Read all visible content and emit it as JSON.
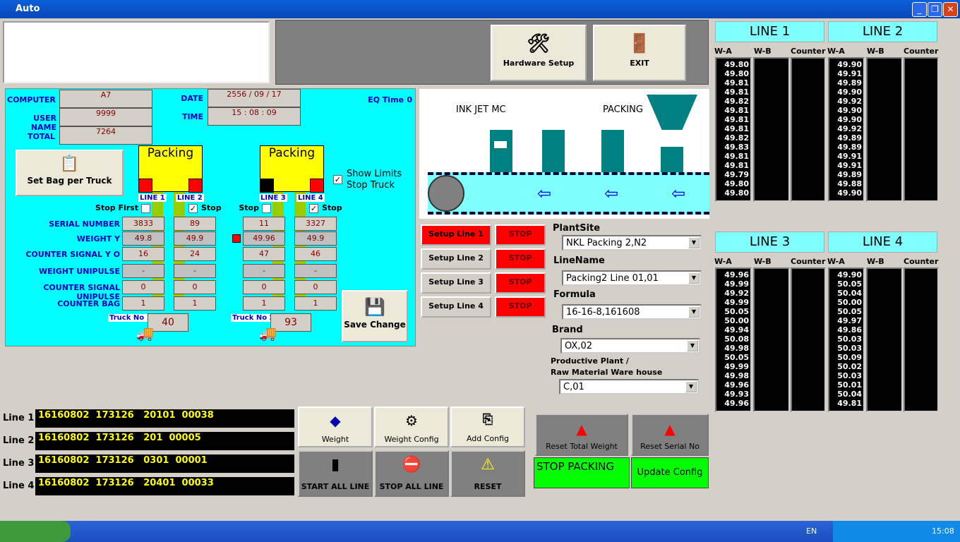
{
  "window": {
    "title": "Auto",
    "min": "_",
    "max": "❐",
    "close": "✕"
  },
  "toolbar": {
    "hardware_setup": "Hardware Setup",
    "exit": "EXIT"
  },
  "info": {
    "computer_label": "COMPUTER",
    "computer_value": "A7",
    "username_label": "USER NAME",
    "username_value": "9999",
    "total_label": "TOTAL",
    "total_value": "7264",
    "date_label": "DATE",
    "date_value": "2556 / 09 / 17",
    "time_label": "TIME",
    "time_value": "15 : 08 : 09",
    "eq_time_label": "EQ Time",
    "eq_time_value": "0"
  },
  "set_bag_button": "Set Bag per Truck",
  "packing_label": "Packing",
  "show_limits": "Show Limits",
  "stop_truck": "Stop Truck",
  "show_limits_checked": true,
  "row_labels": [
    "SERIAL NUMBER",
    "WEIGHT Y",
    "COUNTER SIGNAL Y O",
    "WEIGHT UNIPULSE",
    "COUNTER SIGNAL UNIPULSE",
    "COUNTER BAG"
  ],
  "lines": [
    {
      "label": "LINE 1",
      "stop_label": "Stop First",
      "stop_checked": false,
      "values": [
        "3833",
        "49.8",
        "16",
        "-",
        "0",
        "1"
      ],
      "lamp_color": "#ff0000"
    },
    {
      "label": "LINE 2",
      "stop_label": "Stop",
      "stop_checked": true,
      "values": [
        "89",
        "49.9",
        "24",
        "-",
        "0",
        "1"
      ],
      "lamp_color": "#ff0000"
    },
    {
      "label": "LINE 3",
      "stop_label": "Stop",
      "stop_checked": false,
      "values": [
        "11",
        "49.96",
        "47",
        "-",
        "0",
        "1"
      ],
      "lamp_color": "#000000"
    },
    {
      "label": "LINE 4",
      "stop_label": "Stop",
      "stop_checked": true,
      "values": [
        "3327",
        "49.9",
        "46",
        "-",
        "0",
        "1"
      ],
      "lamp_color": "#ff0000"
    }
  ],
  "trucks": [
    {
      "label": "Truck No 1",
      "value": "40"
    },
    {
      "label": "Truck No 2",
      "value": "93"
    }
  ],
  "save_change": "Save Change",
  "diagram": {
    "inkjet": "INK JET MC",
    "packing": "PACKING"
  },
  "setup_buttons": [
    {
      "label": "Setup Line 1",
      "stop": "STOP",
      "active": true
    },
    {
      "label": "Setup Line 2",
      "stop": "STOP",
      "active": false
    },
    {
      "label": "Setup Line 3",
      "stop": "STOP",
      "active": false
    },
    {
      "label": "Setup Line 4",
      "stop": "STOP",
      "active": false
    }
  ],
  "form": {
    "plantsite_label": "PlantSite",
    "plantsite": "NKL Packing 2,N2",
    "linename_label": "LineName",
    "linename": "Packing2 Line 01,01",
    "formula_label": "Formula",
    "formula": "16-16-8,161608",
    "brand_label": "Brand",
    "brand": "OX,02",
    "plant_label1": "Productive Plant /",
    "plant_label2": "Raw Material Ware house",
    "plant": "C,01"
  },
  "monitors": [
    {
      "title": "LINE 1",
      "wa": [
        "49.80",
        "49.80",
        "49.81",
        "49.81",
        "49.82",
        "49.81",
        "49.81",
        "49.81",
        "49.82",
        "49.83",
        "49.81",
        "49.81",
        "49.79",
        "49.80",
        "49.80"
      ]
    },
    {
      "title": "LINE 2",
      "wa": [
        "49.90",
        "49.91",
        "49.89",
        "49.90",
        "49.92",
        "49.90",
        "49.90",
        "49.92",
        "49.89",
        "49.89",
        "49.91",
        "49.91",
        "49.89",
        "49.88",
        "49.90"
      ]
    },
    {
      "title": "LINE 3",
      "wa": [
        "49.96",
        "49.99",
        "49.92",
        "49.99",
        "50.05",
        "50.00",
        "49.94",
        "50.08",
        "49.98",
        "50.05",
        "49.99",
        "49.98",
        "49.96",
        "49.93",
        "49.96"
      ]
    },
    {
      "title": "LINE 4",
      "wa": [
        "49.90",
        "50.05",
        "50.04",
        "50.00",
        "50.05",
        "49.97",
        "49.86",
        "50.03",
        "50.03",
        "50.09",
        "50.02",
        "50.03",
        "50.01",
        "50.04",
        "49.81"
      ]
    }
  ],
  "col_headers": {
    "wa": "W-A",
    "wb": "W-B",
    "counter": "Counter"
  },
  "code_lines": [
    {
      "label": "Line 1",
      "text": "16160802  173126   20101  00038"
    },
    {
      "label": "Line 2",
      "text": "16160802  173126   201  00005"
    },
    {
      "label": "Line 3",
      "text": "16160802  173126   0301  00001"
    },
    {
      "label": "Line 4",
      "text": "16160802  173126   20401  00033"
    }
  ],
  "actions": {
    "weight": "Weight",
    "weight_config": "Weight Config",
    "add_config": "Add Config",
    "start_all": "START ALL LINE",
    "stop_all": "STOP ALL LINE",
    "reset": "RESET",
    "reset_total": "Reset Total Weight",
    "reset_serial": "Reset Serial No",
    "stop_packing": "STOP PACKING",
    "update_config": "Update Config"
  },
  "taskbar": {
    "lang": "EN",
    "clock": "15:08"
  }
}
